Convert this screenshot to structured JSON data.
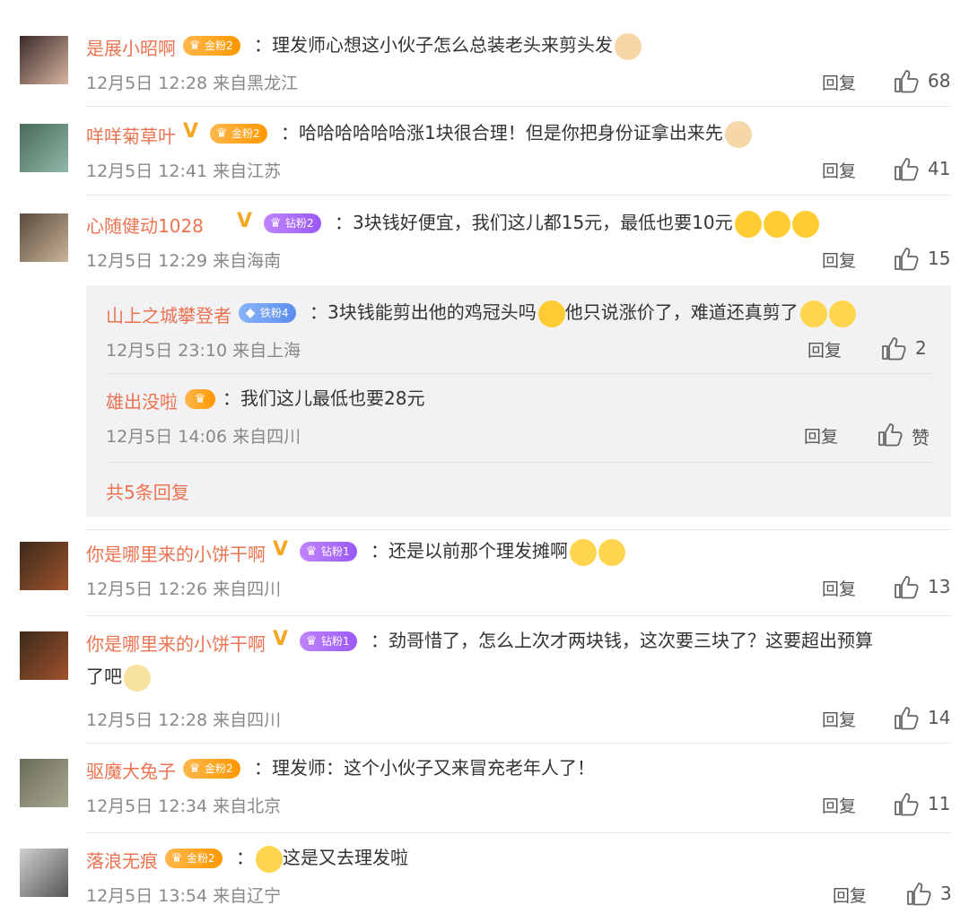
{
  "comments": [
    {
      "name": "是展小昭啊",
      "badge": "金粉2",
      "badge_type": "gold",
      "verified": false,
      "text": "理发师心想这小伙子怎么总装老头来剪头发",
      "emojis": [
        "cat"
      ],
      "date": "12月5日 12:28 来自黑龙江",
      "reply": "回复",
      "likes": "68"
    },
    {
      "name": "咩咩菊草叶",
      "badge": "金粉2",
      "badge_type": "gold",
      "verified": true,
      "text": "哈哈哈哈哈哈涨1块很合理！但是你把身份证拿出来先",
      "emojis": [
        "cat"
      ],
      "date": "12月5日 12:41 来自江苏",
      "reply": "回复",
      "likes": "41"
    },
    {
      "name": "心随健动1028",
      "badge": "钻粉2",
      "badge_type": "diamond",
      "verified": true,
      "text": "3块钱好便宜，我们这儿都15元，最低也要10元",
      "emojis": [
        "laugh",
        "laugh",
        "laugh"
      ],
      "date": "12月5日 12:29 来自海南",
      "reply": "回复",
      "likes": "15"
    },
    {
      "name": "你是哪里来的小饼干啊",
      "badge": "钻粉1",
      "badge_type": "diamond",
      "verified": true,
      "text": "还是以前那个理发摊啊",
      "emojis": [
        "cry",
        "cry"
      ],
      "date": "12月5日 12:26 来自四川",
      "reply": "回复",
      "likes": "13"
    },
    {
      "name": "你是哪里来的小饼干啊",
      "badge": "钻粉1",
      "badge_type": "diamond",
      "verified": true,
      "text": "劲哥惜了，怎么上次才两块钱，这次要三块了？这要超出预算",
      "text2": "了吧",
      "emojis": [
        "dog"
      ],
      "date": "12月5日 12:28 来自四川",
      "reply": "回复",
      "likes": "14"
    },
    {
      "name": "驱魔大兔子",
      "badge": "金粉2",
      "badge_type": "gold",
      "verified": false,
      "text": "理发师：这个小伙子又来冒充老年人了！",
      "emojis": [],
      "date": "12月5日 12:34 来自北京",
      "reply": "回复",
      "likes": "11"
    },
    {
      "name": "落浪无痕",
      "badge": "金粉2",
      "badge_type": "gold",
      "verified": false,
      "text": "这是又去理发啦",
      "emojis_before": [
        "cry"
      ],
      "emojis": [],
      "date": "12月5日 13:54 来自辽宁",
      "reply": "回复",
      "likes": "3"
    }
  ],
  "subreplies": [
    {
      "name": "山上之城攀登者",
      "badge": "铁粉4",
      "badge_type": "iron",
      "text": "3块钱能剪出他的鸡冠头吗",
      "text_b": "他只说涨价了，难道还真剪了",
      "date": "12月5日 23:10 来自上海",
      "reply": "回复",
      "likes": "2"
    },
    {
      "name": "雄出没啦",
      "badge": "",
      "badge_type": "crown",
      "text": "我们这儿最低也要28元",
      "date": "12月5日 14:06 来自四川",
      "reply": "回复",
      "likes": "赞"
    }
  ],
  "more_replies": "共5条回复",
  "colors": {
    "name": "#eb7350",
    "meta": "#888888",
    "accent_gold": "#ff9800",
    "accent_diamond": "#9b59f6",
    "accent_iron": "#5b8def"
  }
}
